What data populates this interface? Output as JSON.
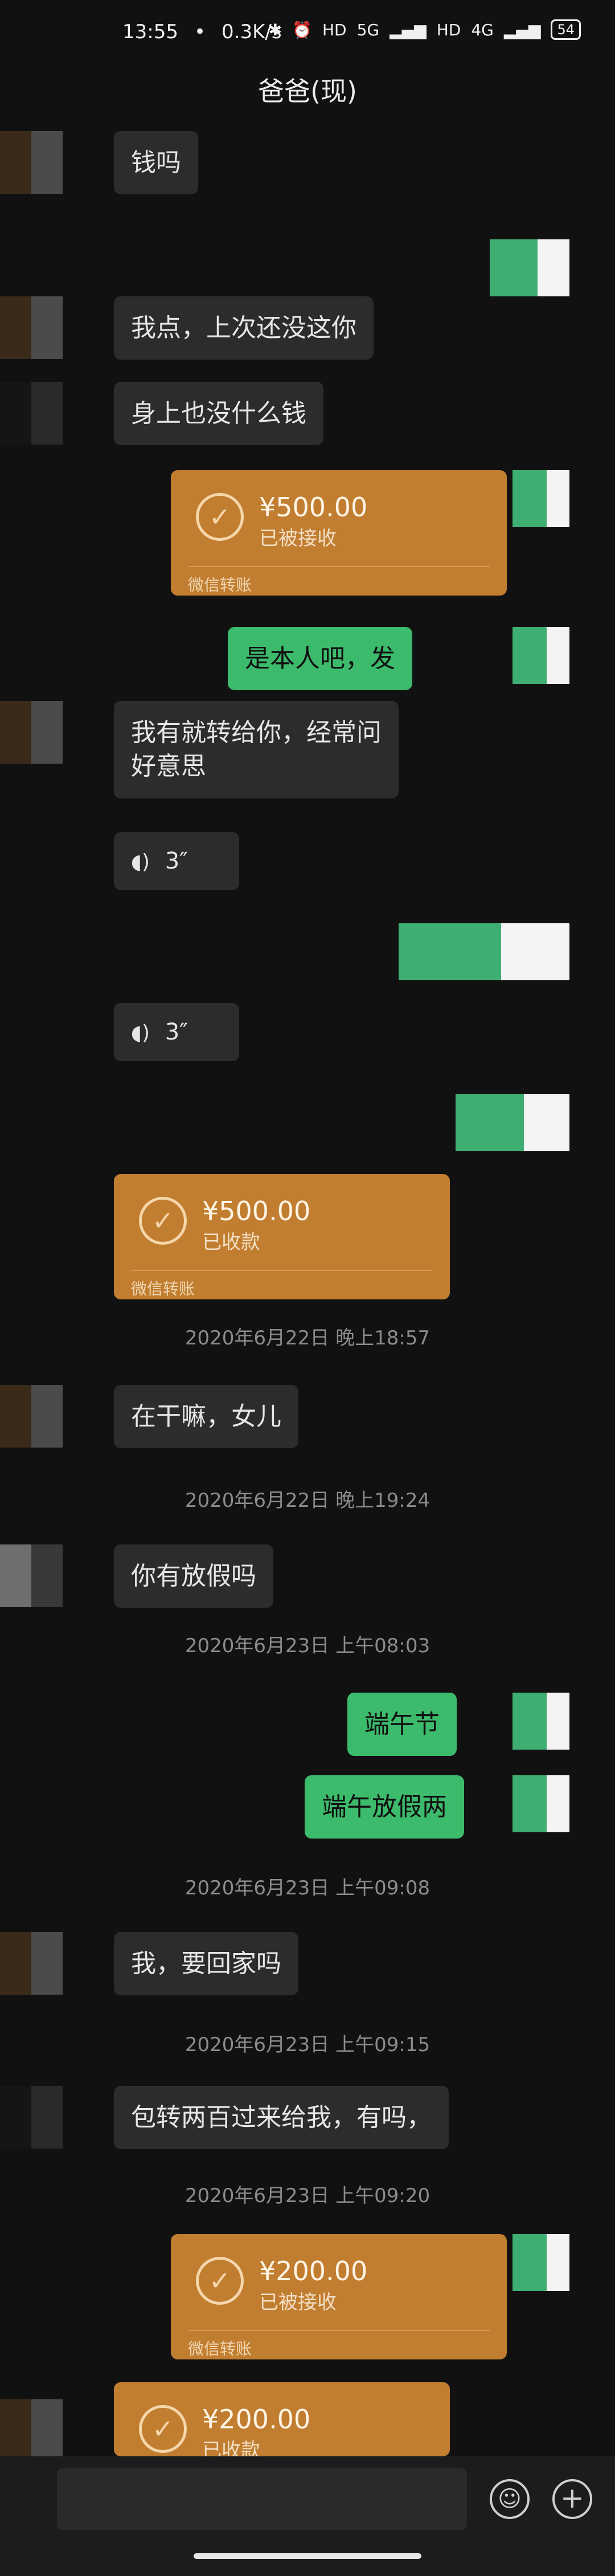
{
  "status_bar": {
    "time": "13:55",
    "speed": "0.3K/s",
    "battery": "54",
    "net_5g": "5G",
    "net_4g": "4G",
    "hd": "HD"
  },
  "chat": {
    "title": "爸爸(现)"
  },
  "messages": {
    "m1": "钱吗",
    "m2": "我点，上次还没这你",
    "m3": "身上也没什么钱",
    "m4": "是本人吧，发",
    "m5a": "我有就转给你，经常问",
    "m5b": "好意思",
    "m6": "在干嘛，女儿",
    "m7": "你有放假吗",
    "m8": "端午节",
    "m9": "端午放假两",
    "m10": "我，要回家吗",
    "m11": "包转两百过来给我，有吗，"
  },
  "voice": {
    "v1": "3″",
    "v2": "3″"
  },
  "timestamps": {
    "t1": "2020年6月22日 晚上18:57",
    "t2": "2020年6月22日 晚上19:24",
    "t3": "2020年6月23日 上午08:03",
    "t4": "2020年6月23日 上午09:08",
    "t5": "2020年6月23日 上午09:15",
    "t6": "2020年6月23日 上午09:20"
  },
  "transfers": {
    "tr1": {
      "amount": "¥500.00",
      "status": "已被接收",
      "footer": "微信转账"
    },
    "tr2": {
      "amount": "¥500.00",
      "status": "已收款",
      "footer": "微信转账"
    },
    "tr3": {
      "amount": "¥200.00",
      "status": "已被接收",
      "footer": "微信转账"
    },
    "tr4": {
      "amount": "¥200.00",
      "status": "已收款"
    }
  },
  "icons": {
    "check": "✓",
    "voice_wave": "◖)",
    "emoji": "☺",
    "plus": "+"
  }
}
